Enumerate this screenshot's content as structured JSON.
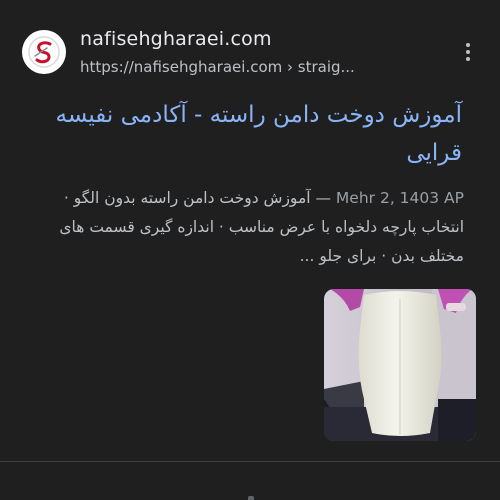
{
  "result": {
    "site_name": "nafisehgharaei.com",
    "url": "https://nafisehgharaei.com › straig...",
    "title": "آموزش دوخت دامن راسته - آکادمی نفیسه قرایی",
    "date": "Mehr 2, 1403 AP",
    "date_separator": " — ",
    "snippet": "آموزش دوخت دامن راسته بدون الگو · انتخاب پارچه دلخواه با عرض مناسب · اندازه گیری قسمت های مختلف بدن · برای جلو ...",
    "favicon_icon": "site-logo-icon",
    "thumbnail_icon": "skirt-photo"
  },
  "colors": {
    "background": "#1f1f1f",
    "title_link": "#8ab4f8",
    "site_text": "#e8eaed",
    "snippet_text": "#bdc1c6",
    "logo_red": "#c8102e"
  }
}
